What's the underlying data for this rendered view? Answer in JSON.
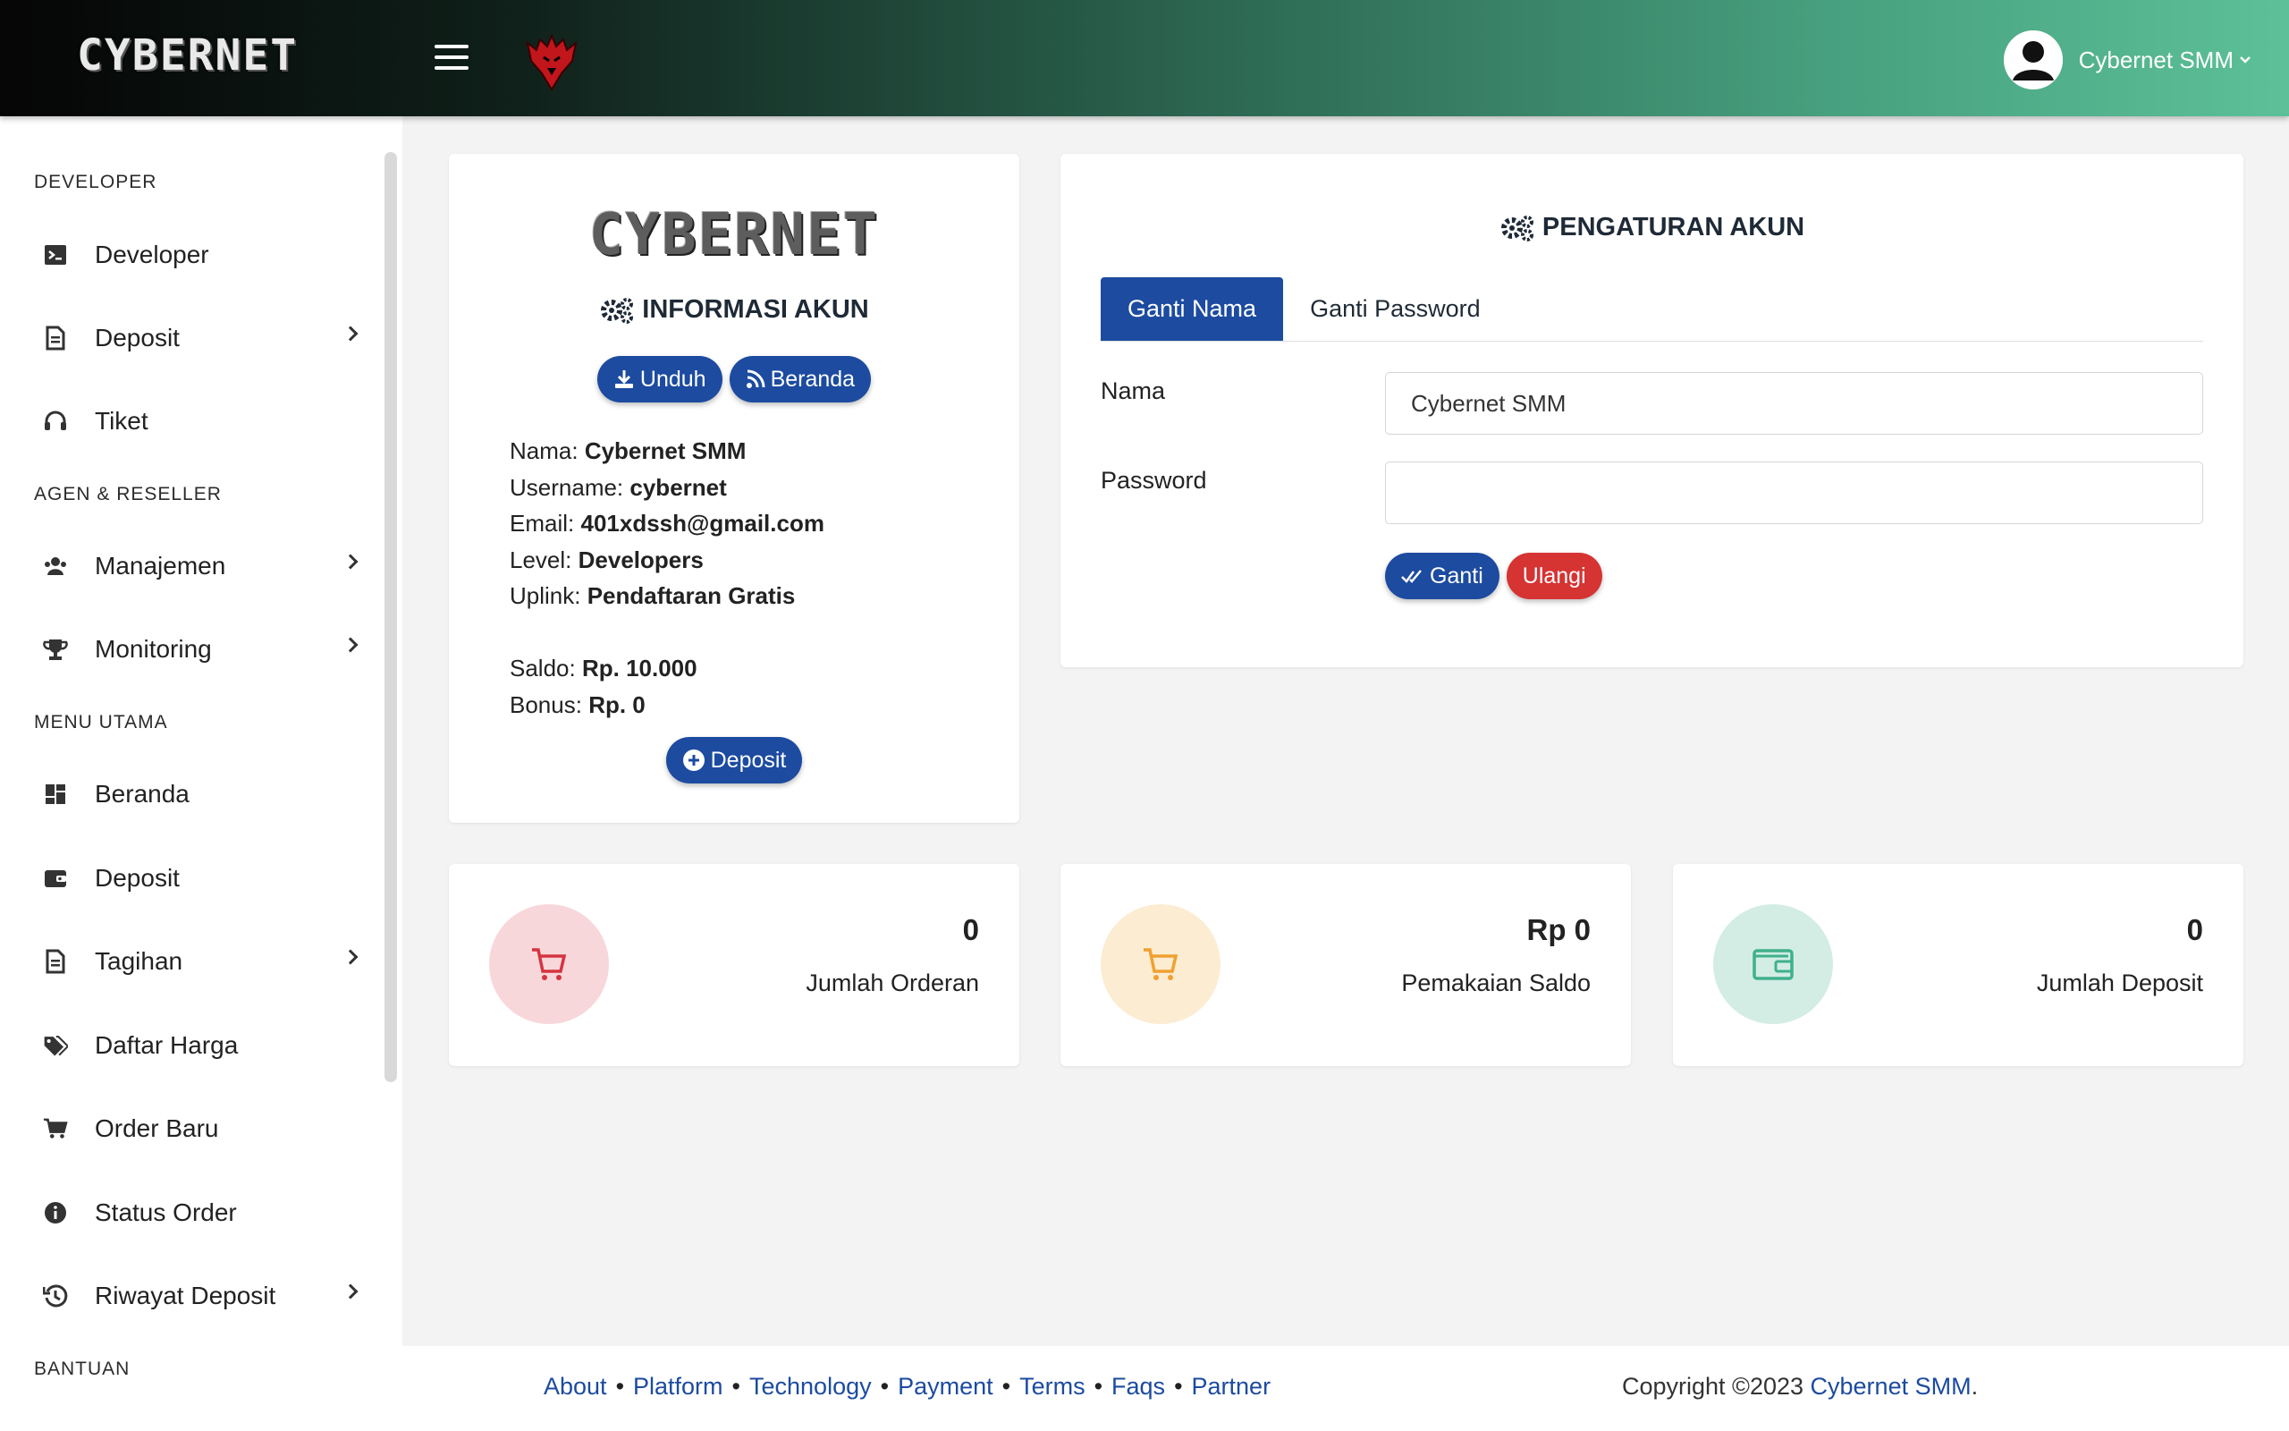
{
  "header": {
    "brand": "CYBERNET",
    "user_name": "Cybernet SMM"
  },
  "sidebar": {
    "sections": [
      {
        "heading": "DEVELOPER"
      },
      {
        "heading": "AGEN & RESELLER"
      },
      {
        "heading": "MENU UTAMA"
      },
      {
        "heading": "BANTUAN"
      }
    ],
    "items": [
      {
        "label": "Developer",
        "icon": "terminal-icon",
        "submenu": false
      },
      {
        "label": "Deposit",
        "icon": "document-icon",
        "submenu": true
      },
      {
        "label": "Tiket",
        "icon": "headset-icon",
        "submenu": false
      },
      {
        "label": "Manajemen",
        "icon": "users-icon",
        "submenu": true
      },
      {
        "label": "Monitoring",
        "icon": "trophy-icon",
        "submenu": true
      },
      {
        "label": "Beranda",
        "icon": "dashboard-icon",
        "submenu": false
      },
      {
        "label": "Deposit",
        "icon": "wallet-icon",
        "submenu": false
      },
      {
        "label": "Tagihan",
        "icon": "invoice-icon",
        "submenu": true
      },
      {
        "label": "Daftar Harga",
        "icon": "tags-icon",
        "submenu": false
      },
      {
        "label": "Order Baru",
        "icon": "cart-icon",
        "submenu": false
      },
      {
        "label": "Status Order",
        "icon": "info-icon",
        "submenu": false
      },
      {
        "label": "Riwayat Deposit",
        "icon": "history-icon",
        "submenu": true
      }
    ]
  },
  "account_info": {
    "logo": "CYBERNET",
    "title": "INFORMASI AKUN",
    "download_label": "Unduh",
    "home_label": "Beranda",
    "fields": [
      {
        "label": "Nama:",
        "value": "Cybernet SMM"
      },
      {
        "label": "Username:",
        "value": "cybernet"
      },
      {
        "label": "Email:",
        "value": "401xdssh@gmail.com"
      },
      {
        "label": "Level:",
        "value": "Developers"
      },
      {
        "label": "Uplink:",
        "value": "Pendaftaran Gratis"
      }
    ],
    "balance_fields": [
      {
        "label": "Saldo:",
        "value": "Rp. 10.000"
      },
      {
        "label": "Bonus:",
        "value": "Rp. 0"
      }
    ],
    "deposit_label": "Deposit"
  },
  "settings": {
    "title": "PENGATURAN AKUN",
    "tabs": [
      {
        "label": "Ganti Nama",
        "active": true
      },
      {
        "label": "Ganti Password",
        "active": false
      }
    ],
    "name_label": "Nama",
    "name_value": "Cybernet SMM",
    "password_label": "Password",
    "password_value": "",
    "submit_label": "Ganti",
    "reset_label": "Ulangi"
  },
  "stats": [
    {
      "value": "0",
      "label": "Jumlah Orderan",
      "icon": "cart-icon",
      "color": "#d63340",
      "bg": "#f8d7db"
    },
    {
      "value": "Rp 0",
      "label": "Pemakaian Saldo",
      "icon": "cart-icon",
      "color": "#f0a030",
      "bg": "#fcecd2"
    },
    {
      "value": "0",
      "label": "Jumlah Deposit",
      "icon": "wallet-icon",
      "color": "#3fb08c",
      "bg": "#d3ede5"
    }
  ],
  "footer": {
    "links": [
      "About",
      "Platform",
      "Technology",
      "Payment",
      "Terms",
      "Faqs",
      "Partner"
    ],
    "separator": "•",
    "copyright_prefix": "Copyright ©2023",
    "copyright_brand": "Cybernet SMM",
    "copyright_suffix": "."
  },
  "colors": {
    "primary": "#1c4ba0",
    "danger": "#d63333"
  }
}
